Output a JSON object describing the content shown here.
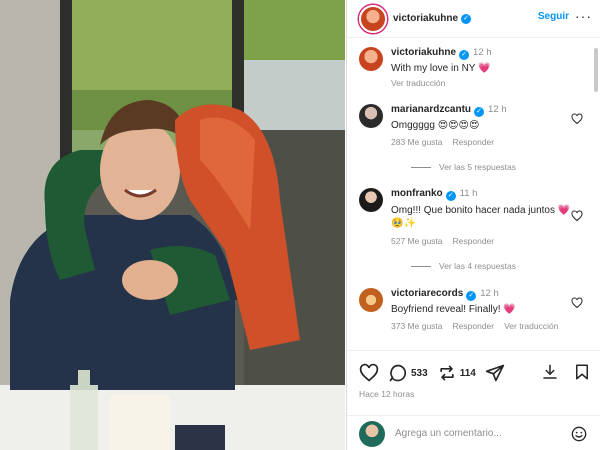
{
  "post": {
    "username": "victoriakuhne",
    "follow_label": "Seguir",
    "more_label": "···"
  },
  "caption": {
    "username": "victoriakuhne",
    "time": "12 h",
    "text": "With my love in NY 💗",
    "translate_label": "Ver traducción"
  },
  "comments": [
    {
      "username": "marianardzcantu",
      "time": "12 h",
      "text": "Omggggg 😍😍😍😍",
      "likes": "283 Me gusta",
      "reply_label": "Responder",
      "replies_label": "Ver las 5 respuestas"
    },
    {
      "username": "monfranko",
      "time": "11 h",
      "text": "Omg!!! Que bonito hacer nada juntos 💗🥹✨",
      "likes": "527 Me gusta",
      "reply_label": "Responder",
      "replies_label": "Ver las 4 respuestas"
    },
    {
      "username": "victoriarecords",
      "time": "12 h",
      "text": "Boyfriend reveal! Finally! 💗",
      "likes": "373 Me gusta",
      "reply_label": "Responder",
      "translate_label": "Ver traducción"
    }
  ],
  "actions": {
    "comment_count": "533",
    "repost_count": "114",
    "time_ago": "Hace 12 horas"
  },
  "add_comment": {
    "placeholder": "Agrega un comentario..."
  },
  "colors": {
    "accent": "#0095f6",
    "text": "#262626",
    "muted": "#8e8e8e",
    "border": "#dbdbdb"
  },
  "icons": [
    "verified-icon",
    "more-icon",
    "heart-icon",
    "comment-icon",
    "repost-icon",
    "share-icon",
    "save-icon",
    "emoji-icon"
  ]
}
